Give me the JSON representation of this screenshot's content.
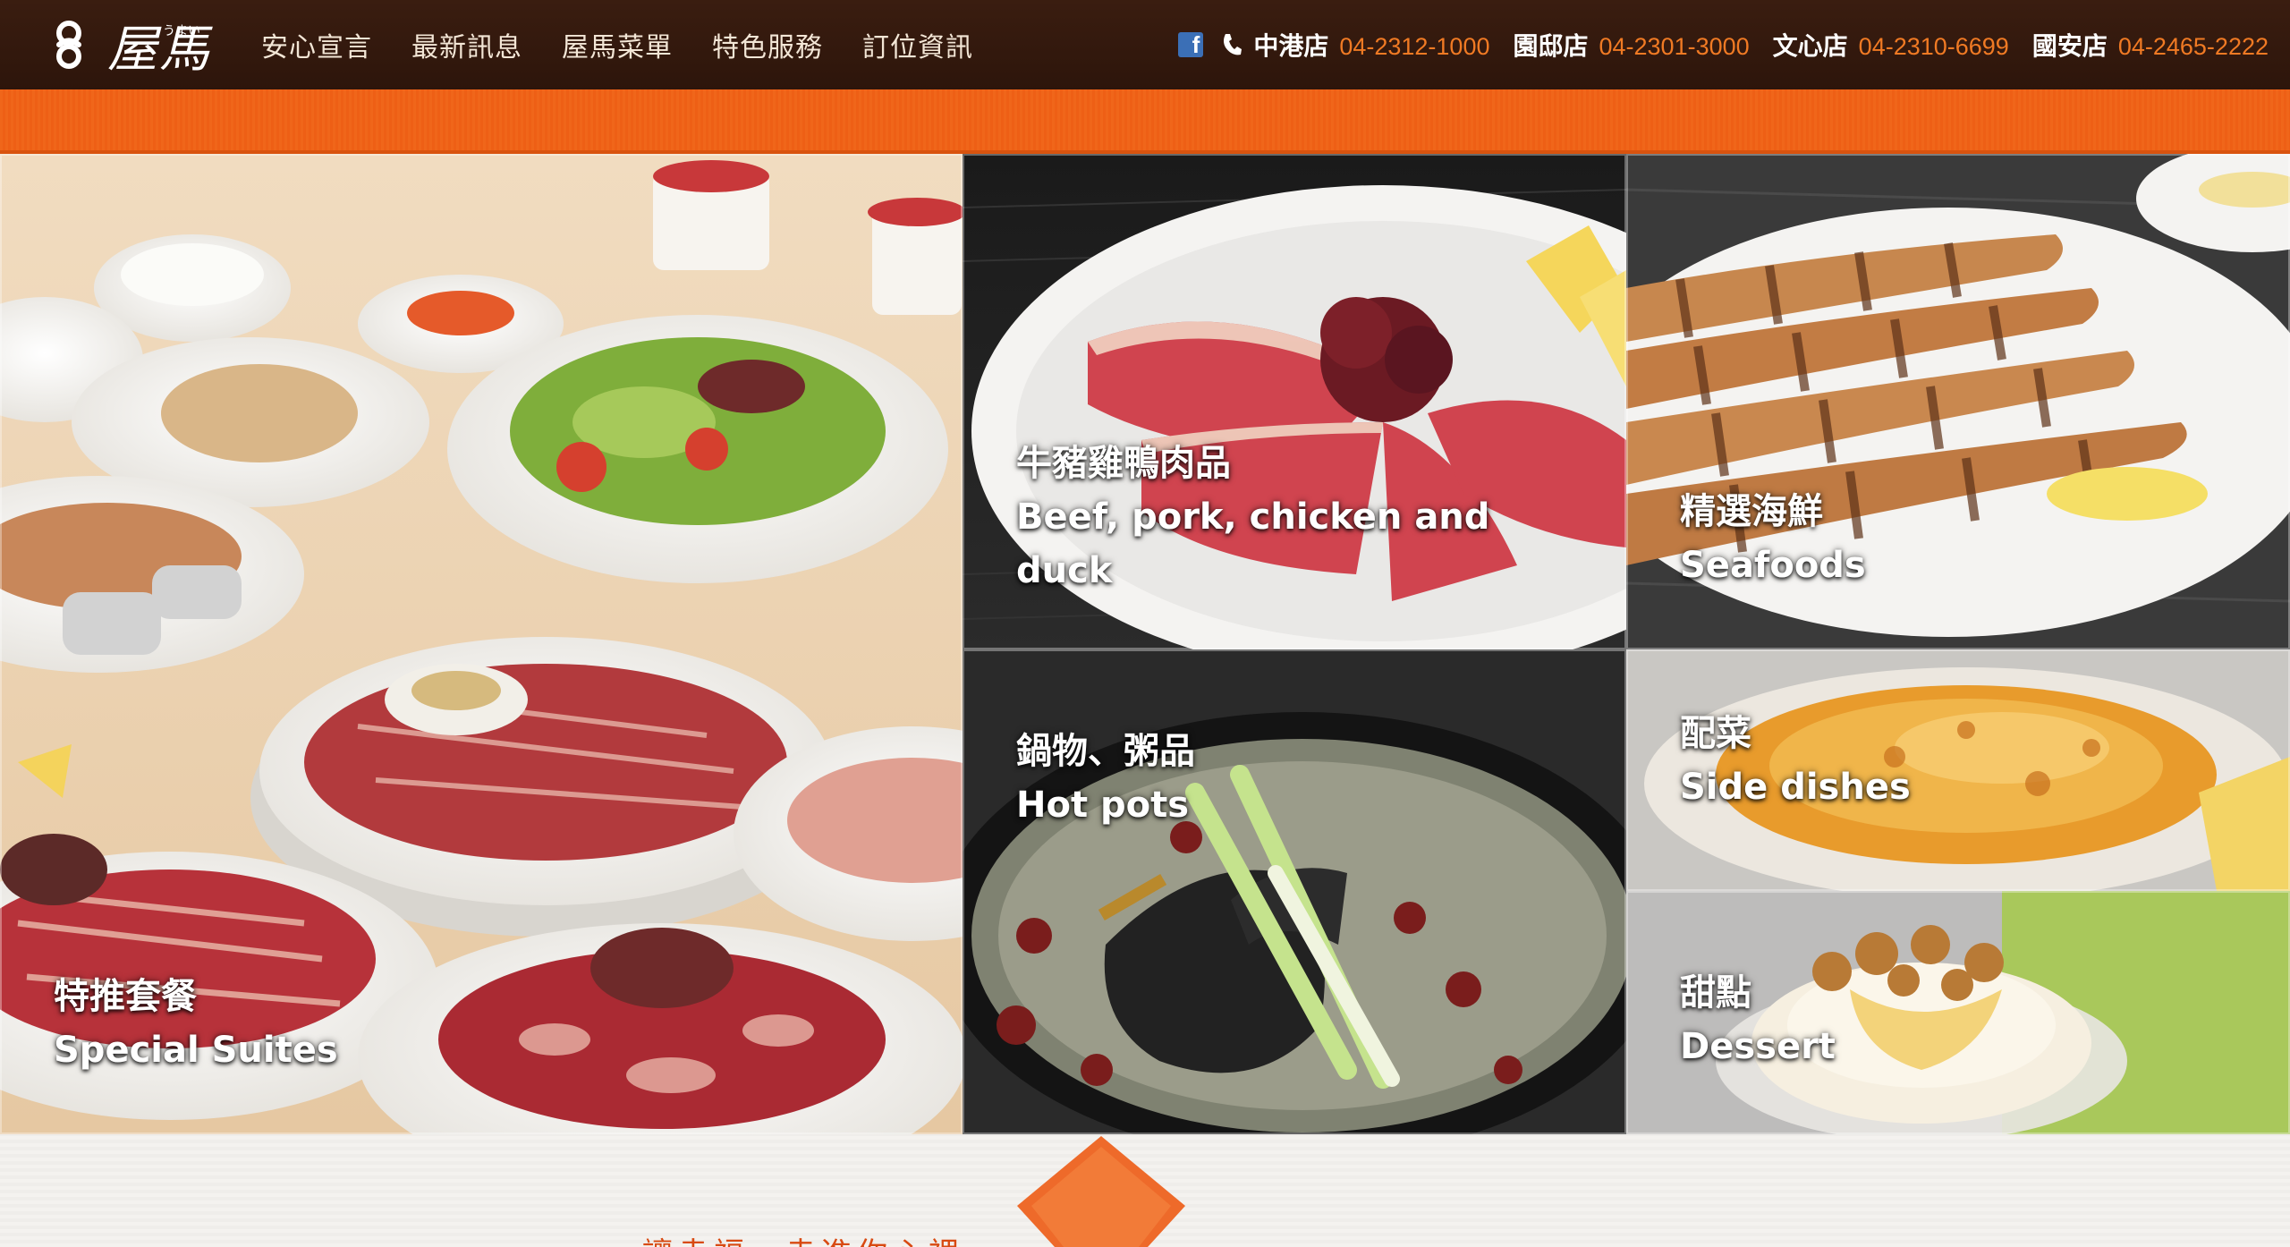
{
  "brand": {
    "logo_text": "屋馬",
    "logo_kana": "うまい"
  },
  "nav": {
    "items": [
      "安心宣言",
      "最新訊息",
      "屋馬菜單",
      "特色服務",
      "訂位資訊"
    ]
  },
  "contact": {
    "icons": [
      "facebook-icon",
      "phone-icon"
    ],
    "stores": [
      {
        "name": "中港店",
        "phone": "04-2312-1000"
      },
      {
        "name": "園邸店",
        "phone": "04-2301-3000"
      },
      {
        "name": "文心店",
        "phone": "04-2310-6699"
      },
      {
        "name": "國安店",
        "phone": "04-2465-2222"
      }
    ]
  },
  "menu": {
    "tiles": [
      {
        "zh": "特推套餐",
        "en": "Special Suites"
      },
      {
        "zh": "牛豬雞鴨肉品",
        "en": "Beef, pork, chicken and",
        "en2": "duck"
      },
      {
        "zh": "精選海鮮",
        "en": "Seafoods"
      },
      {
        "zh": "鍋物、粥品",
        "en": "Hot pots"
      },
      {
        "zh": "配菜",
        "en": "Side dishes"
      },
      {
        "zh": "甜點",
        "en": "Dessert"
      }
    ]
  },
  "footer": {
    "slogan": "讓幸福，走進你心裡"
  },
  "colors": {
    "header_bg": "#2d150b",
    "accent_orange": "#ef641a",
    "phone_orange": "#f07a24",
    "slogan_red": "#d84a12"
  }
}
